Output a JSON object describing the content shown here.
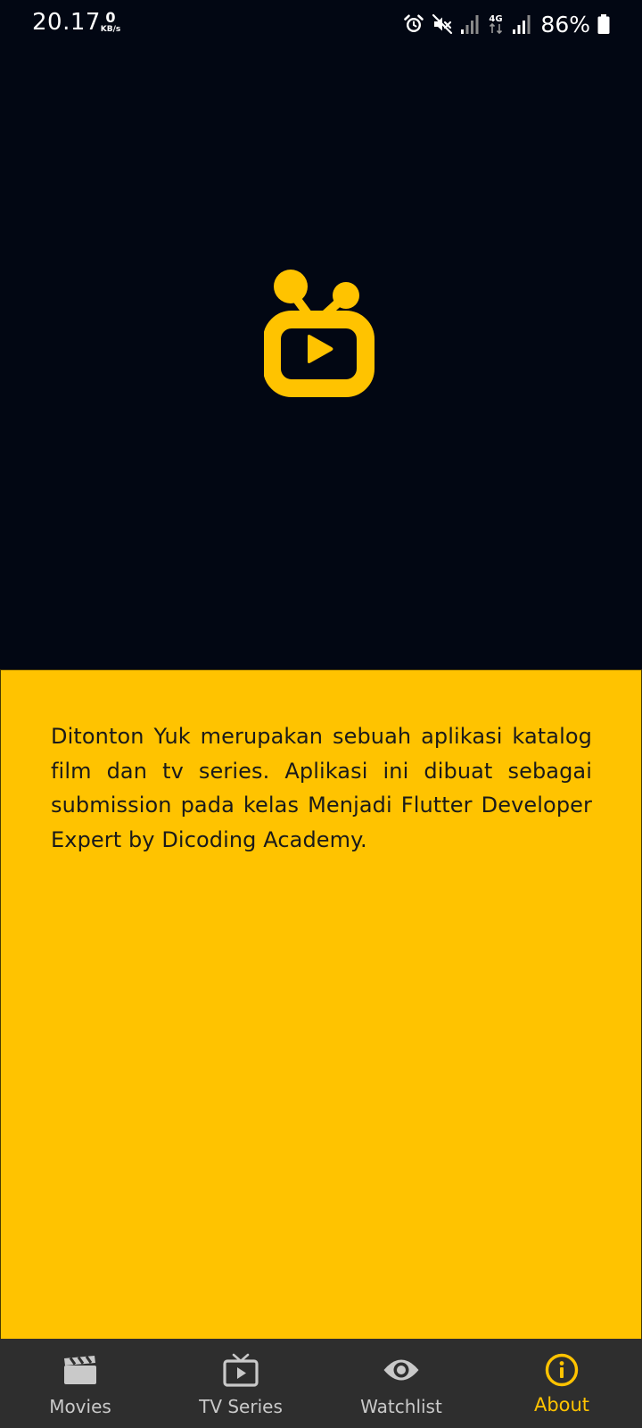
{
  "status_bar": {
    "time": "20.17",
    "net_speed_value": "0",
    "net_speed_unit": "KB/s",
    "network_type": "4G",
    "battery_percent": "86%",
    "icons": [
      "alarm-icon",
      "mute-icon",
      "signal-icon",
      "4g-data-icon",
      "signal-icon",
      "battery-icon"
    ]
  },
  "hero": {
    "logo_icon": "tv-play-logo",
    "accent_color": "#FFC300",
    "background_color": "#020713"
  },
  "about": {
    "description": "Ditonton Yuk merupakan sebuah aplikasi katalog film dan tv series. Aplikasi ini dibuat sebagai submission pada kelas Menjadi Flutter Developer Expert by Dicoding Academy."
  },
  "bottom_nav": {
    "items": [
      {
        "label": "Movies",
        "icon": "clapperboard-icon",
        "active": false
      },
      {
        "label": "TV Series",
        "icon": "tv-icon",
        "active": false
      },
      {
        "label": "Watchlist",
        "icon": "eye-icon",
        "active": false
      },
      {
        "label": "About",
        "icon": "info-icon",
        "active": true
      }
    ],
    "active_color": "#FFC300",
    "inactive_color": "#c9c9c9"
  }
}
